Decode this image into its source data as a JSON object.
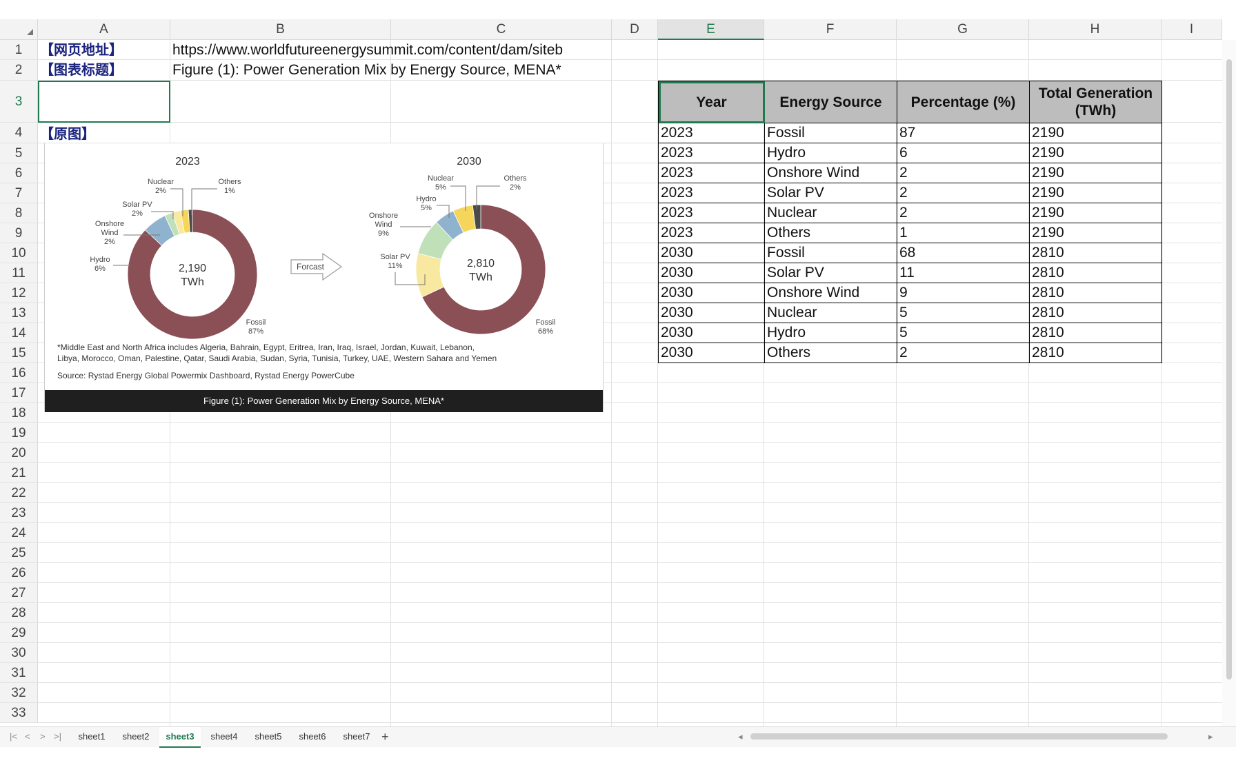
{
  "columns": [
    {
      "label": "A"
    },
    {
      "label": "B"
    },
    {
      "label": "C"
    },
    {
      "label": "D"
    },
    {
      "label": "E"
    },
    {
      "label": "F"
    },
    {
      "label": "G"
    },
    {
      "label": "H"
    },
    {
      "label": "I"
    }
  ],
  "rows": [
    "1",
    "2",
    "3",
    "4",
    "5",
    "6",
    "7",
    "8",
    "9",
    "10",
    "11",
    "12",
    "13",
    "14",
    "15",
    "16",
    "17",
    "18",
    "19",
    "20",
    "21",
    "22",
    "23",
    "24",
    "25",
    "26",
    "27",
    "28",
    "29",
    "30",
    "31",
    "32",
    "33"
  ],
  "cells": {
    "a1": "【网页地址】",
    "b1": "https://www.worldfutureenergysummit.com/content/dam/siteb",
    "a2": "【图表标题】",
    "b2": "Figure (1): Power Generation Mix by Energy Source, MENA*",
    "a4": "【原图】"
  },
  "table": {
    "headers": [
      "Year",
      "Energy Source",
      "Percentage (%)",
      "Total Generation (TWh)"
    ],
    "rows": [
      [
        "2023",
        "Fossil",
        "87",
        "2190"
      ],
      [
        "2023",
        "Hydro",
        "6",
        "2190"
      ],
      [
        "2023",
        "Onshore Wind",
        "2",
        "2190"
      ],
      [
        "2023",
        "Solar PV",
        "2",
        "2190"
      ],
      [
        "2023",
        "Nuclear",
        "2",
        "2190"
      ],
      [
        "2023",
        "Others",
        "1",
        "2190"
      ],
      [
        "2030",
        "Fossil",
        "68",
        "2810"
      ],
      [
        "2030",
        "Solar PV",
        "11",
        "2810"
      ],
      [
        "2030",
        "Onshore Wind",
        "9",
        "2810"
      ],
      [
        "2030",
        "Nuclear",
        "5",
        "2810"
      ],
      [
        "2030",
        "Hydro",
        "5",
        "2810"
      ],
      [
        "2030",
        "Others",
        "2",
        "2810"
      ]
    ]
  },
  "figure": {
    "title_2023": "2023",
    "title_2030": "2030",
    "center_2023_value": "2,190",
    "center_2023_unit": "TWh",
    "center_2030_value": "2,810",
    "center_2030_unit": "TWh",
    "arrow_label": "Forcast",
    "labels_2023": {
      "nuclear": "Nuclear",
      "nuclear_pct": "2%",
      "others": "Others",
      "others_pct": "1%",
      "solar": "Solar PV",
      "solar_pct": "2%",
      "wind_1": "Onshore",
      "wind_2": "Wind",
      "wind_pct": "2%",
      "hydro": "Hydro",
      "hydro_pct": "6%",
      "fossil": "Fossil",
      "fossil_pct": "87%"
    },
    "labels_2030": {
      "nuclear": "Nuclear",
      "nuclear_pct": "5%",
      "others": "Others",
      "others_pct": "2%",
      "hydro": "Hydro",
      "hydro_pct": "5%",
      "wind_1": "Onshore",
      "wind_2": "Wind",
      "wind_pct": "9%",
      "solar": "Solar PV",
      "solar_pct": "11%",
      "fossil": "Fossil",
      "fossil_pct": "68%"
    },
    "footnote_1": "*Middle East and North Africa includes Algeria, Bahrain, Egypt, Eritrea, Iran, Iraq, Israel, Jordan, Kuwait, Lebanon,",
    "footnote_2": "Libya, Morocco, Oman, Palestine, Qatar, Saudi Arabia, Sudan, Syria, Tunisia, Turkey, UAE, Western Sahara and Yemen",
    "source": "Source: Rystad Energy Global Powermix Dashboard, Rystad Energy PowerCube",
    "caption": "Figure (1): Power Generation Mix by Energy Source, MENA*",
    "colors": {
      "fossil": "#8b4f56",
      "hydro": "#8fb3cf",
      "wind": "#bfe0b8",
      "solar": "#f8e8a0",
      "nuclear": "#f5d65a",
      "others": "#4a4a4a"
    }
  },
  "tabs": [
    "sheet1",
    "sheet2",
    "sheet3",
    "sheet4",
    "sheet5",
    "sheet6",
    "sheet7"
  ],
  "active_tab": "sheet3",
  "add_tab": "+",
  "nav": {
    "first": "|<",
    "prev": "<",
    "next": ">",
    "last": ">|"
  }
}
